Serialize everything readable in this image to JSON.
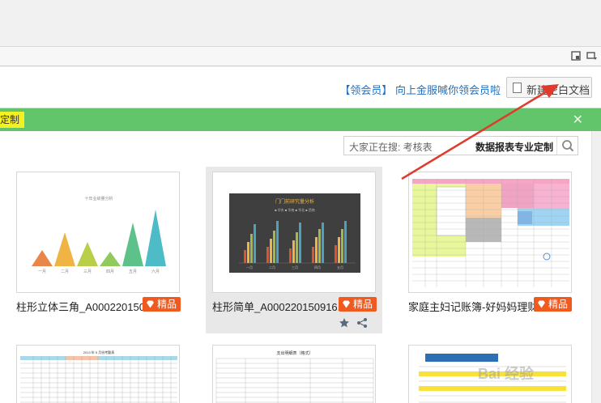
{
  "header": {
    "promo_prefix": "【领会员】",
    "promo_text": "向上金服喊你领会员啦",
    "new_doc_label": "新建空白文档"
  },
  "banner": {
    "tag_label": "定制"
  },
  "search": {
    "placeholder": "大家正在搜: 考核表",
    "keyword": "数据报表专业定制"
  },
  "badge_label": "精品",
  "templates": [
    {
      "title": "柱形立体三角_A000220150..."
    },
    {
      "title": "柱形简单_A000220150916..."
    },
    {
      "title": "家庭主妇记账簿-好妈妈理财"
    }
  ],
  "thumbs": {
    "t1_title": "十年业绩量分析",
    "t1_cats": [
      "一月",
      "二月",
      "三月",
      "四月",
      "五月",
      "六月"
    ],
    "t2_title": "门门前研究量分析",
    "t2_legend": [
      "■ 华东",
      "■ 华南",
      "■ 华北",
      "■ 西南"
    ],
    "t2_cats": [
      "一月",
      "二月",
      "三月",
      "四月",
      "五月"
    ],
    "t5_title": "支出明细表（格式）",
    "t4_title": "2013 年 5 月份考勤表"
  },
  "watermark": "Bai 经验",
  "colors": {
    "green_bar": "#62c46b",
    "tag_yellow": "#f5f020",
    "badge_orange": "#f05a1e",
    "link_blue": "#1f6fbf",
    "arrow_red": "#e03a2c"
  },
  "icons": [
    "window-icon",
    "menu-icon",
    "document-icon",
    "close-icon",
    "search-icon",
    "gem-icon",
    "star-icon",
    "share-icon"
  ]
}
